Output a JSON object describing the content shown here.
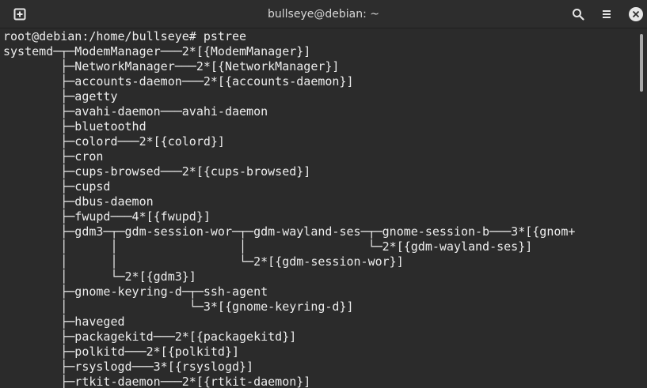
{
  "window": {
    "title": "bullseye@debian: ~",
    "new_tab_icon": "new-tab-icon",
    "search_icon": "search-icon",
    "menu_icon": "hamburger-menu-icon",
    "close_icon": "close-icon"
  },
  "terminal": {
    "lines": [
      "root@debian:/home/bullseye# pstree",
      "systemd─┬─ModemManager───2*[{ModemManager}]",
      "        ├─NetworkManager───2*[{NetworkManager}]",
      "        ├─accounts-daemon───2*[{accounts-daemon}]",
      "        ├─agetty",
      "        ├─avahi-daemon───avahi-daemon",
      "        ├─bluetoothd",
      "        ├─colord───2*[{colord}]",
      "        ├─cron",
      "        ├─cups-browsed───2*[{cups-browsed}]",
      "        ├─cupsd",
      "        ├─dbus-daemon",
      "        ├─fwupd───4*[{fwupd}]",
      "        ├─gdm3─┬─gdm-session-wor─┬─gdm-wayland-ses─┬─gnome-session-b───3*[{gnom+",
      "        │      │                 │                 └─2*[{gdm-wayland-ses}]",
      "        │      │                 └─2*[{gdm-session-wor}]",
      "        │      └─2*[{gdm3}]",
      "        ├─gnome-keyring-d─┬─ssh-agent",
      "        │                 └─3*[{gnome-keyring-d}]",
      "        ├─haveged",
      "        ├─packagekitd───2*[{packagekitd}]",
      "        ├─polkitd───2*[{polkitd}]",
      "        ├─rsyslogd───3*[{rsyslogd}]",
      "        ├─rtkit-daemon───2*[{rtkit-daemon}]"
    ]
  },
  "colors": {
    "background": "#2b2b2b",
    "titlebar": "#2d2d2d",
    "text": "#ececec"
  }
}
